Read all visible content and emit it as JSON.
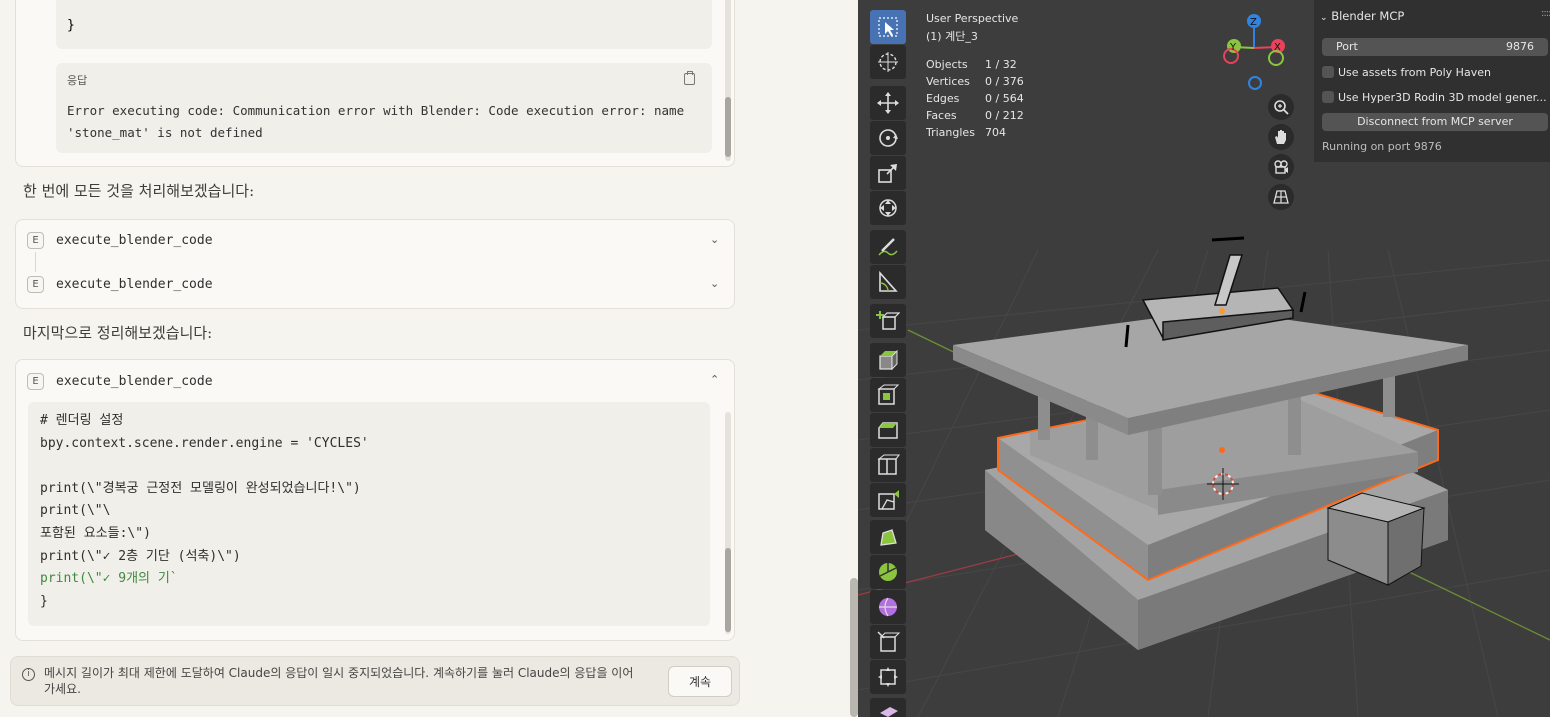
{
  "chat": {
    "prev_code_tail": "}",
    "response_label": "응답",
    "error_text": "Error executing code: Communication error with Blender: Code execution error: name 'stone_mat' is not defined",
    "message_1": "한 번에 모든 것을 처리해보겠습니다:",
    "tool_calls_1": [
      {
        "badge": "E",
        "name": "execute_blender_code"
      },
      {
        "badge": "E",
        "name": "execute_blender_code"
      }
    ],
    "message_2": "마지막으로 정리해보겠습니다:",
    "tool_call_2": {
      "badge": "E",
      "name": "execute_blender_code"
    },
    "code_lines": [
      "# 렌더링 설정",
      "bpy.context.scene.render.engine = 'CYCLES'",
      "",
      "print(\\\"경복궁 근정전 모델링이 완성되었습니다!\\\")",
      "print(\\\"\\",
      "포함된 요소들:\\\")",
      "print(\\\"✓ 2층 기단 (석축)\\\")",
      "print(\\\"✓ 9개의 기`",
      "}"
    ],
    "notice_text": "메시지 길이가 최대 제한에 도달하여 Claude의 응답이 일시 중지되었습니다. 계속하기를 눌러 Claude의 응답을 이어가세요.",
    "continue_label": "계속"
  },
  "blender": {
    "viewport": {
      "view_name": "User Perspective",
      "object_name": "(1) 계단_3",
      "stats": [
        {
          "label": "Objects",
          "value": "1 / 32"
        },
        {
          "label": "Vertices",
          "value": "0 / 376"
        },
        {
          "label": "Edges",
          "value": "0 / 564"
        },
        {
          "label": "Faces",
          "value": "0 / 212"
        },
        {
          "label": "Triangles",
          "value": "704"
        }
      ],
      "gizmo_axes": [
        "Z",
        "Y",
        "X"
      ]
    },
    "toolbar_tools": [
      "select-box",
      "cursor",
      "move",
      "rotate",
      "scale",
      "transform",
      "annotate",
      "measure",
      "add-cube",
      "extrude",
      "inset",
      "bevel",
      "loop-cut",
      "knife",
      "poly-build",
      "spin",
      "smooth",
      "shrink-fatten",
      "shear"
    ],
    "mcp_panel": {
      "title": "Blender MCP",
      "port_label": "Port",
      "port_value": "9876",
      "option_1": "Use assets from Poly Haven",
      "option_2": "Use Hyper3D Rodin 3D model gener...",
      "disconnect_label": "Disconnect from MCP server",
      "status": "Running on port 9876"
    },
    "colors": {
      "selection": "#ff6a1a",
      "active_tool": "#4772b3",
      "axis_x": "#e8435a",
      "axis_y": "#8bc53f",
      "axis_z": "#2f84e3"
    }
  }
}
